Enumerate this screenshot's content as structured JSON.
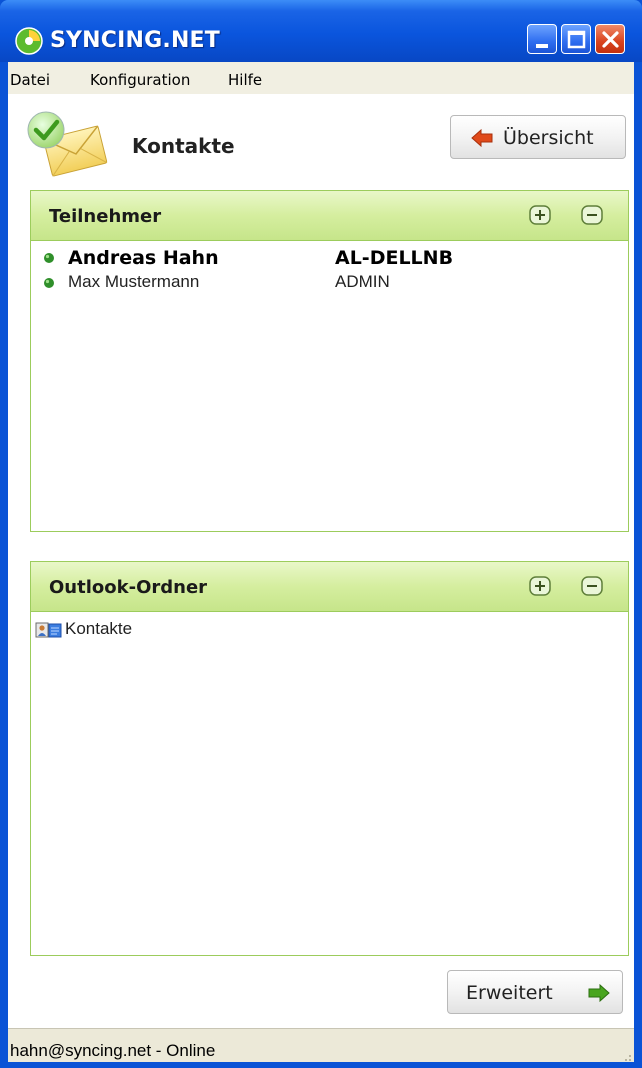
{
  "window": {
    "title": "SYNCING.NET",
    "colors": {
      "titlebar": "#0a55dd",
      "close": "#d9431e"
    }
  },
  "menu": {
    "items": [
      "Datei",
      "Konfiguration",
      "Hilfe"
    ]
  },
  "header": {
    "title": "Kontakte",
    "icon": "contacts-envelope-check-icon",
    "overview_button": "Übersicht"
  },
  "participants_panel": {
    "title": "Teilnehmer",
    "accent": "#c6e58a",
    "rows": [
      {
        "name": "Andreas Hahn",
        "host": "AL-DELLNB",
        "status": "online",
        "bold": true
      },
      {
        "name": "Max Mustermann",
        "host": "ADMIN",
        "status": "online",
        "bold": false
      }
    ]
  },
  "outlook_panel": {
    "title": "Outlook-Ordner",
    "folders": [
      {
        "name": "Kontakte",
        "icon": "contacts-folder-icon"
      }
    ]
  },
  "footer": {
    "advanced_button": "Erweitert"
  },
  "status": {
    "text": "hahn@syncing.net - Online"
  }
}
